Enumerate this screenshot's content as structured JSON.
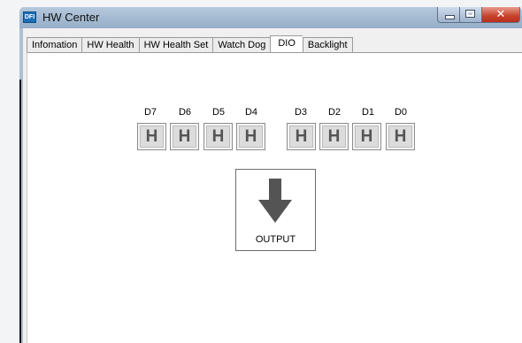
{
  "window": {
    "title": "HW Center",
    "icon_text": "DFI",
    "controls": {
      "minimize": "minimize-icon",
      "maximize": "maximize-icon",
      "close": "✕"
    }
  },
  "tabs": [
    {
      "label": "Infomation",
      "active": false
    },
    {
      "label": "HW Health",
      "active": false
    },
    {
      "label": "HW Health Set",
      "active": false
    },
    {
      "label": "Watch Dog",
      "active": false
    },
    {
      "label": "DIO",
      "active": true
    },
    {
      "label": "Backlight",
      "active": false
    }
  ],
  "dio": {
    "bits": [
      {
        "label": "D7",
        "value": "H"
      },
      {
        "label": "D6",
        "value": "H"
      },
      {
        "label": "D5",
        "value": "H"
      },
      {
        "label": "D4",
        "value": "H"
      },
      {
        "label": "D3",
        "value": "H"
      },
      {
        "label": "D2",
        "value": "H"
      },
      {
        "label": "D1",
        "value": "H"
      },
      {
        "label": "D0",
        "value": "H"
      }
    ],
    "direction": {
      "label": "OUTPUT",
      "icon": "arrow-down-icon"
    }
  },
  "colors": {
    "arrow": "#545454",
    "titlebar": "#a7bcd3",
    "close": "#c7412b"
  }
}
